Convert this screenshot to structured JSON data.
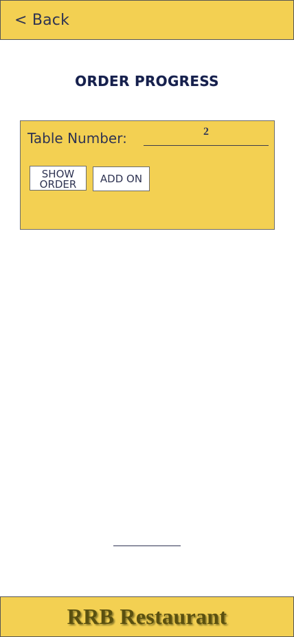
{
  "header": {
    "back_label": "< Back"
  },
  "page": {
    "title": "ORDER PROGRESS"
  },
  "order_panel": {
    "table_label": "Table Number:",
    "table_value": "2",
    "show_order_label_line1": "SHOW",
    "show_order_label_line2": "ORDER",
    "add_on_label": "ADD ON"
  },
  "footer": {
    "brand": "RRB Restaurant"
  },
  "colors": {
    "accent_yellow": "#f3d052",
    "navy_text": "#16204c",
    "brand_olive": "#5a5010"
  }
}
